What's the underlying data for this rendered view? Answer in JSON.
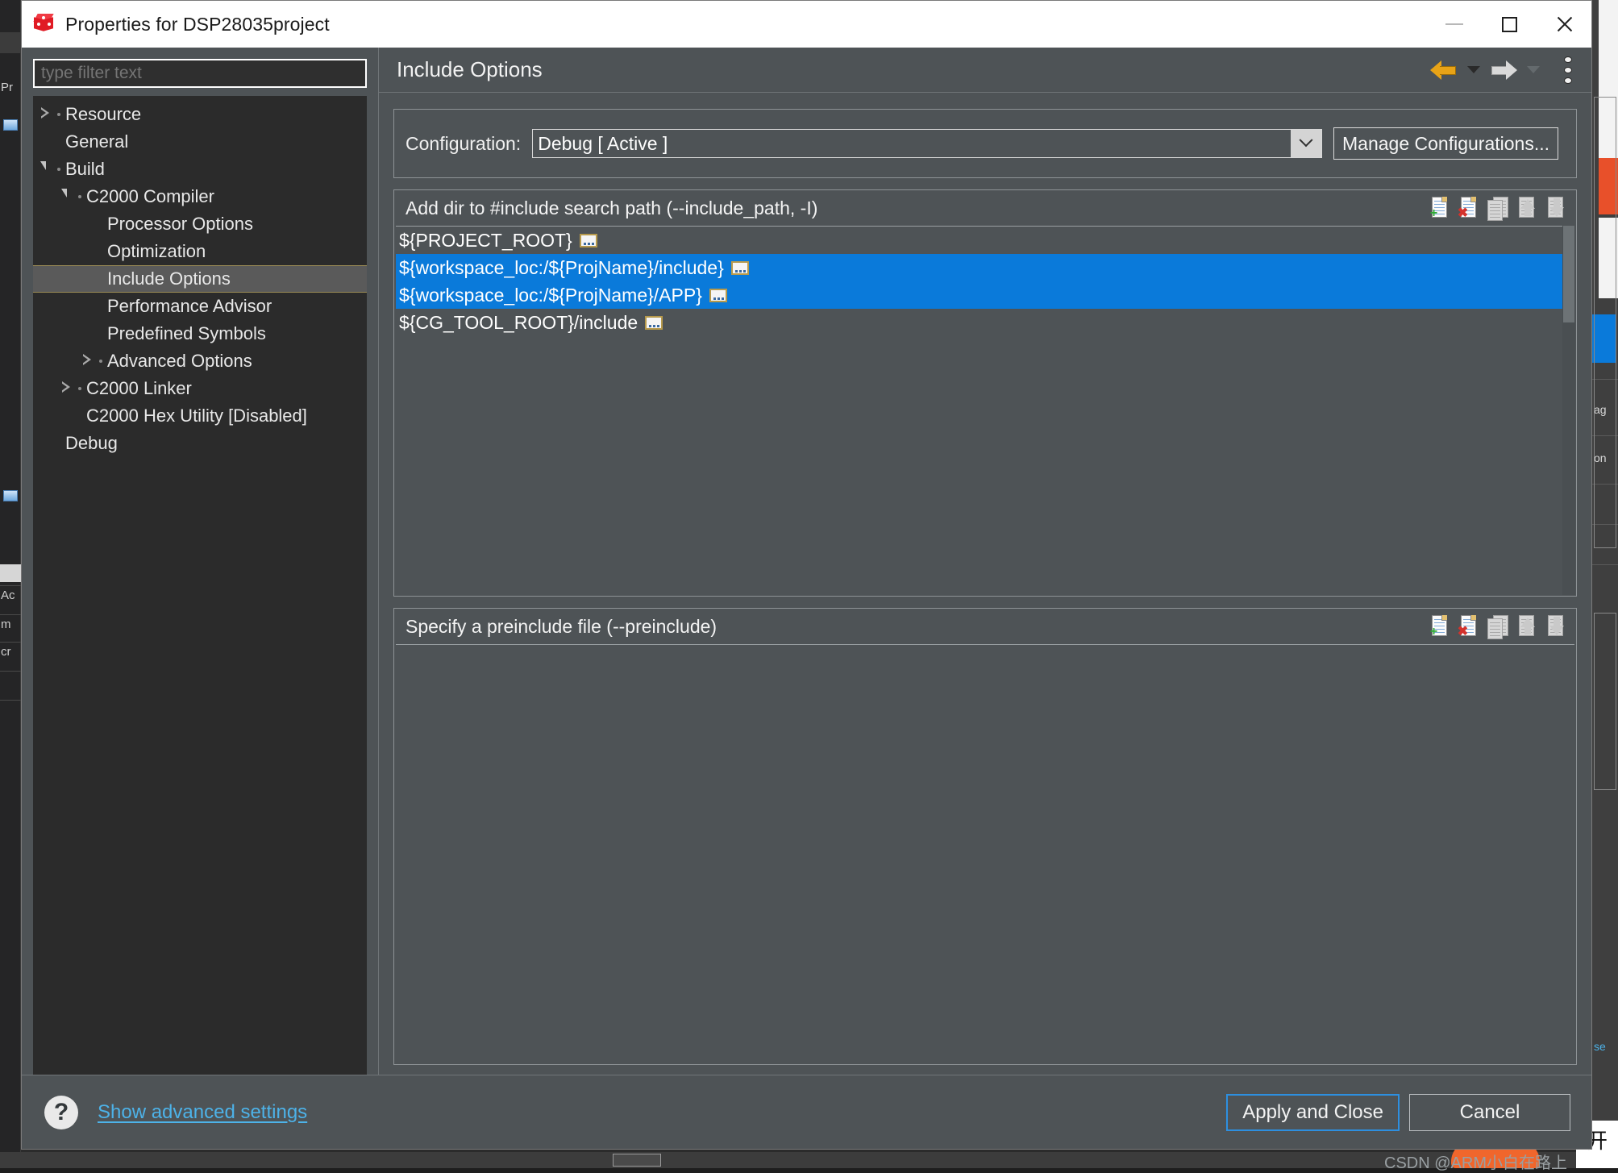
{
  "window": {
    "title": "Properties for DSP28035project",
    "app_icon": "cube-icon",
    "minimize": "minimize-icon",
    "maximize": "maximize-icon",
    "close": "close-icon"
  },
  "filter": {
    "placeholder": "type filter text",
    "value": ""
  },
  "tree": {
    "items": [
      {
        "label": "Resource",
        "indent": 0,
        "twisty": "collapsed",
        "selected": false
      },
      {
        "label": "General",
        "indent": 0,
        "twisty": "none",
        "selected": false
      },
      {
        "label": "Build",
        "indent": 0,
        "twisty": "expanded",
        "selected": false
      },
      {
        "label": "C2000 Compiler",
        "indent": 1,
        "twisty": "expanded",
        "selected": false
      },
      {
        "label": "Processor Options",
        "indent": 2,
        "twisty": "none",
        "selected": false
      },
      {
        "label": "Optimization",
        "indent": 2,
        "twisty": "none",
        "selected": false
      },
      {
        "label": "Include Options",
        "indent": 2,
        "twisty": "none",
        "selected": true
      },
      {
        "label": "Performance Advisor",
        "indent": 2,
        "twisty": "none",
        "selected": false
      },
      {
        "label": "Predefined Symbols",
        "indent": 2,
        "twisty": "none",
        "selected": false
      },
      {
        "label": "Advanced Options",
        "indent": 2,
        "twisty": "collapsed",
        "selected": false
      },
      {
        "label": "C2000 Linker",
        "indent": 1,
        "twisty": "collapsed",
        "selected": false
      },
      {
        "label": "C2000 Hex Utility  [Disabled]",
        "indent": 1,
        "twisty": "none",
        "selected": false
      },
      {
        "label": "Debug",
        "indent": 0,
        "twisty": "none",
        "selected": false
      }
    ]
  },
  "page": {
    "title": "Include Options",
    "nav_back": "back-arrow-icon",
    "nav_back_menu": "back-dropdown-icon",
    "nav_forward": "forward-arrow-icon",
    "nav_forward_menu": "forward-dropdown-icon",
    "view_menu": "view-menu-icon"
  },
  "configuration": {
    "label": "Configuration:",
    "value": "Debug  [ Active ]",
    "options": [
      "Debug  [ Active ]"
    ],
    "manage_label": "Manage Configurations..."
  },
  "include_paths": {
    "title": "Add dir to #include search path (--include_path, -I)",
    "tools": [
      {
        "name": "add-include-path-button",
        "icon": "sheet-plus-icon",
        "enabled": true
      },
      {
        "name": "delete-include-path-button",
        "icon": "sheet-delete-icon",
        "enabled": true
      },
      {
        "name": "edit-include-path-button",
        "icon": "sheet-edit-icon",
        "enabled": false
      },
      {
        "name": "move-up-button",
        "icon": "arrow-up-icon",
        "enabled": true
      },
      {
        "name": "move-down-button",
        "icon": "arrow-down-icon",
        "enabled": true
      }
    ],
    "rows": [
      {
        "text": "${PROJECT_ROOT}",
        "badge": "variable-badge-icon",
        "selected": false
      },
      {
        "text": "${workspace_loc:/${ProjName}/include}",
        "badge": "variable-badge-icon",
        "selected": true
      },
      {
        "text": "${workspace_loc:/${ProjName}/APP}",
        "badge": "variable-badge-icon",
        "selected": true
      },
      {
        "text": "${CG_TOOL_ROOT}/include",
        "badge": "variable-badge-icon",
        "selected": false
      }
    ]
  },
  "preinclude": {
    "title": "Specify a preinclude file (--preinclude)",
    "tools": [
      {
        "name": "add-preinclude-button",
        "icon": "sheet-plus-icon",
        "enabled": true
      },
      {
        "name": "delete-preinclude-button",
        "icon": "sheet-delete-icon",
        "enabled": true
      },
      {
        "name": "edit-preinclude-button",
        "icon": "sheet-edit-icon",
        "enabled": false
      },
      {
        "name": "move-up-button",
        "icon": "arrow-up-icon",
        "enabled": true
      },
      {
        "name": "move-down-button",
        "icon": "arrow-down-icon",
        "enabled": true
      }
    ],
    "rows": []
  },
  "footer": {
    "help_icon": "help-icon",
    "help_glyph": "?",
    "advanced_link": "Show advanced settings",
    "apply_label": "Apply and Close",
    "cancel_label": "Cancel"
  },
  "watermark": "CSDN @ARM小白在路上",
  "background": {
    "ime_glyph": "开",
    "left_labels": [
      "Pr",
      "Ac",
      "m",
      "cr"
    ],
    "right_labels": [
      "ag",
      "on",
      "se"
    ]
  },
  "colors": {
    "dialog_bg": "#4e5356",
    "tree_bg": "#2b2b2b",
    "selection_blue": "#0a7ada",
    "link_blue": "#4db2e8",
    "accent_orange": "#e8a317",
    "focus_blue": "#2d8fe0",
    "titlebar_bg": "#ffffff"
  }
}
